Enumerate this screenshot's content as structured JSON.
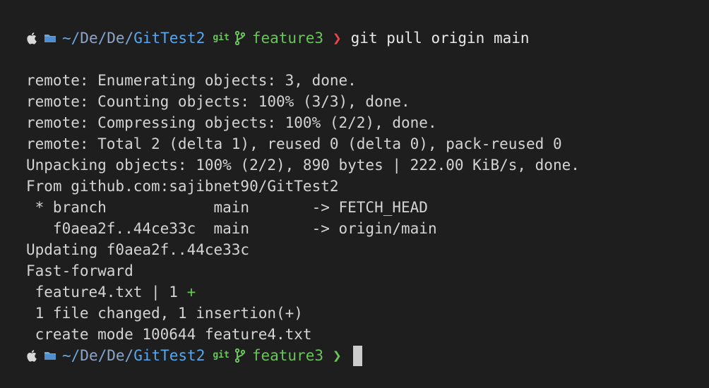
{
  "colors": {
    "background": "#1e1e1e",
    "text": "#d4d4d4",
    "path_blue": "#56a7ef",
    "branch_green": "#6ac45b",
    "chevron_error_red": "#e5484d",
    "chevron_ok_green": "#6ac45b"
  },
  "prompt1": {
    "icons": [
      "apple-icon",
      "folder-icon",
      "git-branch-icon"
    ],
    "path_tilde": "~/",
    "path_part1": "De",
    "path_sep1": "/",
    "path_part2": "De",
    "path_sep2": "/",
    "path_last": "GitTest2",
    "git_label": "git",
    "branch": "feature3",
    "chevron": "❯",
    "command": "git pull origin main"
  },
  "output": [
    "remote: Enumerating objects: 3, done.",
    "remote: Counting objects: 100% (3/3), done.",
    "remote: Compressing objects: 100% (2/2), done.",
    "remote: Total 2 (delta 1), reused 0 (delta 0), pack-reused 0",
    "Unpacking objects: 100% (2/2), 890 bytes | 222.00 KiB/s, done.",
    "From github.com:sajibnet90/GitTest2",
    " * branch            main       -> FETCH_HEAD",
    "   f0aea2f..44ce33c  main       -> origin/main",
    "Updating f0aea2f..44ce33c",
    "Fast-forward"
  ],
  "stat_line": {
    "text": " feature4.txt | 1 ",
    "plus": "+"
  },
  "summary": [
    " 1 file changed, 1 insertion(+)",
    " create mode 100644 feature4.txt"
  ],
  "prompt2": {
    "path_tilde": "~/",
    "path_part1": "De",
    "path_sep1": "/",
    "path_part2": "De",
    "path_sep2": "/",
    "path_last": "GitTest2",
    "git_label": "git",
    "branch": "feature3",
    "chevron": "❯",
    "command": ""
  }
}
